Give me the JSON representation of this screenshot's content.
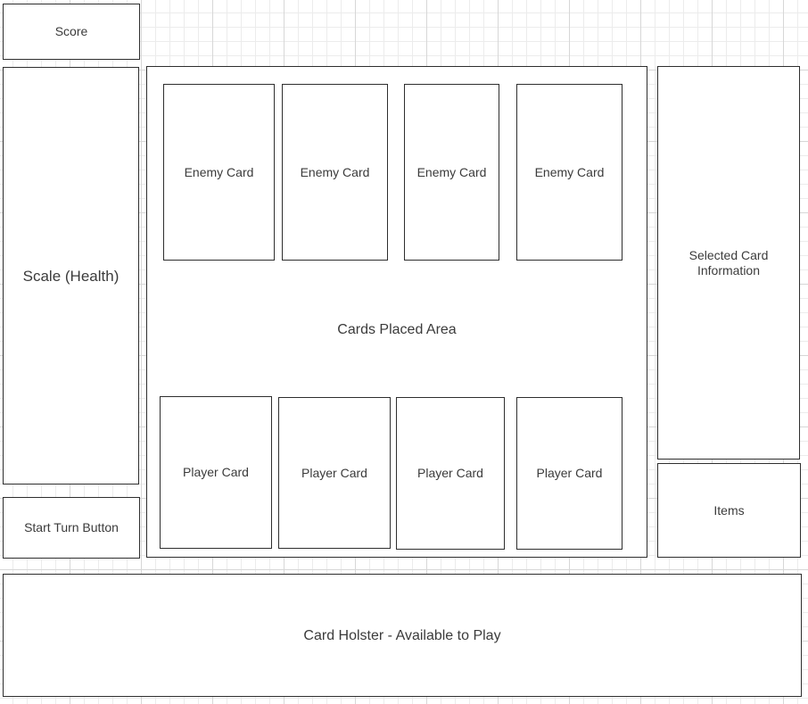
{
  "score": {
    "label": "Score"
  },
  "health": {
    "label": "Scale (Health)"
  },
  "start_turn": {
    "label": "Start Turn Button"
  },
  "play_area": {
    "label": "Cards Placed Area",
    "enemy_cards": [
      {
        "label": "Enemy Card"
      },
      {
        "label": "Enemy Card"
      },
      {
        "label": "Enemy Card"
      },
      {
        "label": "Enemy Card"
      }
    ],
    "player_cards": [
      {
        "label": "Player Card"
      },
      {
        "label": "Player Card"
      },
      {
        "label": "Player Card"
      },
      {
        "label": "Player Card"
      }
    ]
  },
  "selected_info": {
    "label": "Selected Card\nInformation"
  },
  "items": {
    "label": "Items"
  },
  "holster": {
    "label": "Card Holster - Available to Play"
  }
}
